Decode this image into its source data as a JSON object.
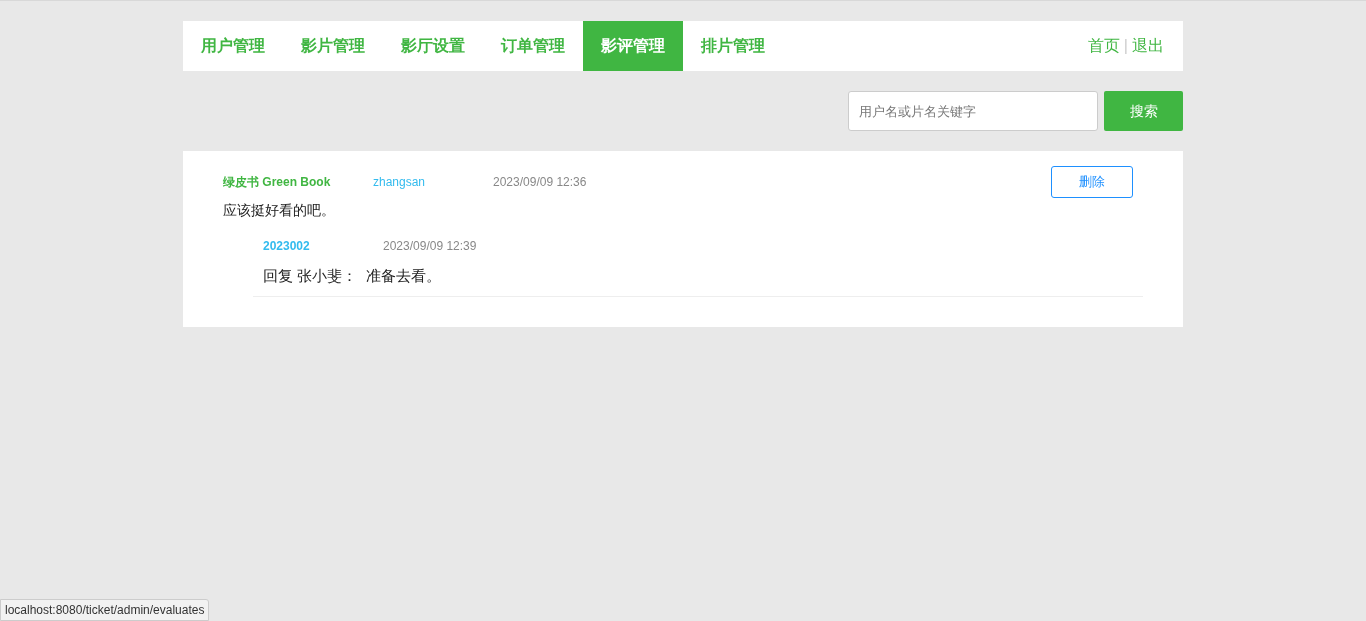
{
  "nav": {
    "tabs": [
      {
        "label": "用户管理",
        "selected": false
      },
      {
        "label": "影片管理",
        "selected": false
      },
      {
        "label": "影厅设置",
        "selected": false
      },
      {
        "label": "订单管理",
        "selected": false
      },
      {
        "label": "影评管理",
        "selected": true
      },
      {
        "label": "排片管理",
        "selected": false
      }
    ],
    "links": [
      "首页",
      "退出"
    ],
    "separator": "|"
  },
  "search": {
    "placeholder": "用户名或片名关键字",
    "button": "搜索"
  },
  "comments": [
    {
      "movie": "绿皮书 Green Book",
      "user": "zhangsan",
      "time": "2023/09/09 12:36",
      "text": "应该挺好看的吧。",
      "delete": "删除",
      "replies": [
        {
          "user": "2023002",
          "time": "2023/09/09 12:39",
          "text": "回复 张小斐：  准备去看。"
        }
      ]
    }
  ],
  "status_url": "localhost:8080/ticket/admin/evaluates"
}
